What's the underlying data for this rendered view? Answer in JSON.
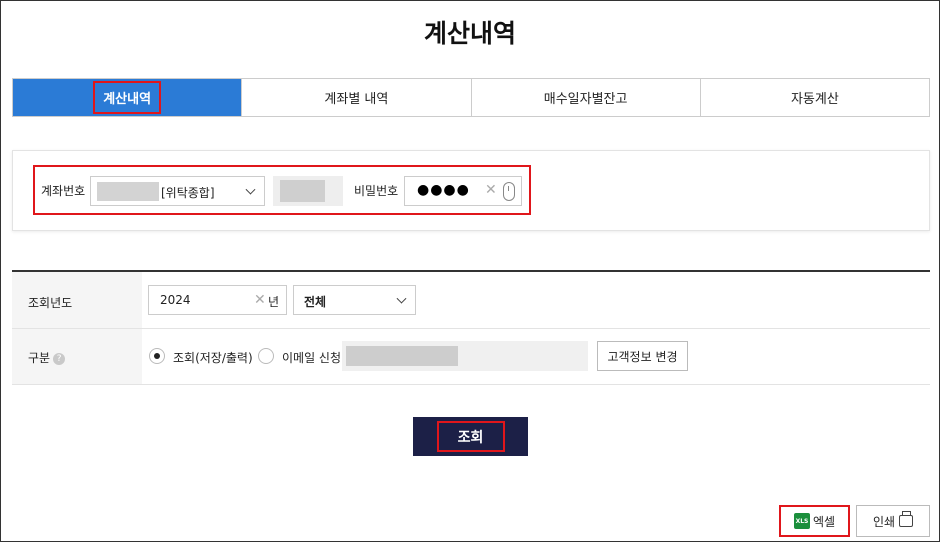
{
  "page": {
    "title": "계산내역"
  },
  "tabs": [
    {
      "label": "계산내역",
      "active": true
    },
    {
      "label": "계좌별 내역",
      "active": false
    },
    {
      "label": "매수일자별잔고",
      "active": false
    },
    {
      "label": "자동계산",
      "active": false
    }
  ],
  "account": {
    "account_label": "계좌번호",
    "account_type": "[위탁종합]",
    "password_label": "비밀번호",
    "password_value": "●●●●"
  },
  "query": {
    "year_label": "조회년도",
    "year_value": "2024",
    "year_suffix": "년",
    "period_value": "전체",
    "type_label": "구분",
    "help_glyph": "?",
    "option_query": "조회(저장/출력)",
    "option_email": "이메일 신청",
    "change_info_button": "고객정보 변경",
    "submit_button": "조회"
  },
  "footer": {
    "excel_icon_text": "XLS",
    "excel_button": "엑셀",
    "print_button": "인쇄"
  },
  "colors": {
    "active_tab": "#2b7bd6",
    "highlight": "#e0161b",
    "submit_bg": "#1c2047"
  }
}
